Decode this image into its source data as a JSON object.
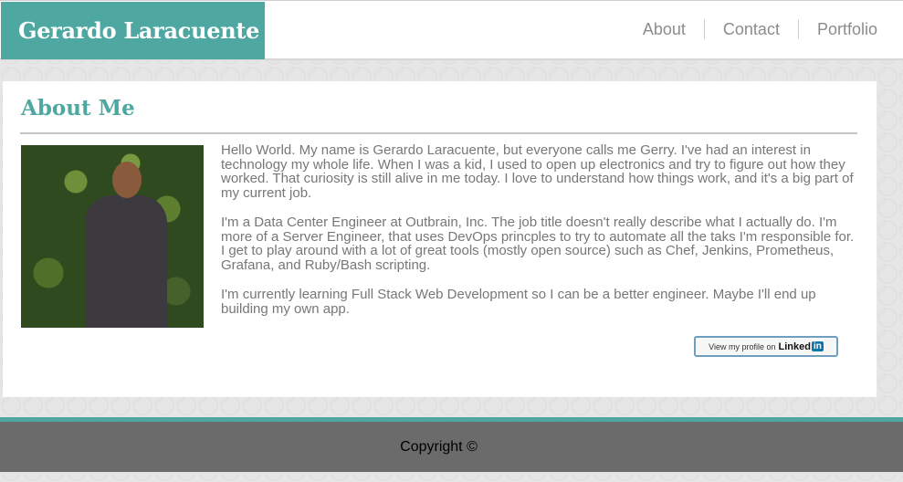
{
  "header": {
    "site_title": "Gerardo Laracuente",
    "nav": [
      {
        "label": "About"
      },
      {
        "label": "Contact"
      },
      {
        "label": "Portfolio"
      }
    ]
  },
  "about": {
    "heading": "About Me",
    "paragraphs": [
      "Hello World. My name is Gerardo Laracuente, but everyone calls me Gerry. I've had an interest in technology my whole life. When I was a kid, I used to open up electronics and try to figure out how they worked. That curiosity is still alive in me today. I love to understand how things work, and it's a big part of my current job.",
      "I'm a Data Center Engineer at Outbrain, Inc. The job title doesn't really describe what I actually do. I'm more of a Server Engineer, that uses DevOps princples to try to automate all the taks I'm responsible for. I get to play around with a lot of great tools (mostly open source) such as Chef, Jenkins, Prometheus, Grafana, and Ruby/Bash scripting.",
      "I'm currently learning Full Stack Web Development so I can be a better engineer. Maybe I'll end up building my own app."
    ],
    "linkedin_badge": {
      "prefix": "View my profile on",
      "brand": "Linked",
      "brand_suffix": "in"
    }
  },
  "footer": {
    "copyright": "Copyright ©"
  },
  "colors": {
    "accent": "#4ea8a1",
    "footer_bg": "#6b6b6b",
    "text": "#777777"
  }
}
